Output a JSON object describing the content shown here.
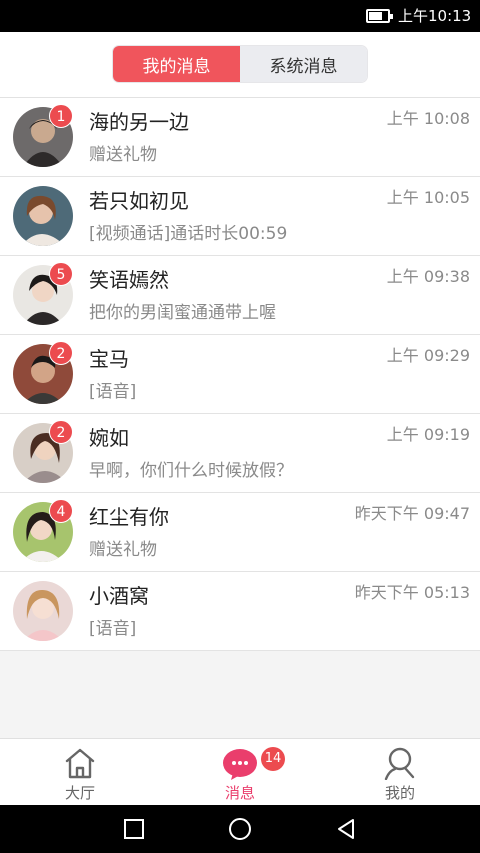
{
  "status_bar": {
    "time": "上午10:13",
    "battery_level": 0.7
  },
  "tabs": {
    "my_messages": "我的消息",
    "system_messages": "系统消息"
  },
  "messages": [
    {
      "name": "海的另一边",
      "preview": "赠送礼物",
      "time": "上午 10:08",
      "unread": "1",
      "avatar": "avatar-1"
    },
    {
      "name": "若只如初见",
      "preview": "[视频通话]通话时长00:59",
      "time": "上午 10:05",
      "unread": "",
      "avatar": "avatar-2"
    },
    {
      "name": "笑语嫣然",
      "preview": "把你的男闺蜜通通带上喔",
      "time": "上午 09:38",
      "unread": "5",
      "avatar": "avatar-3"
    },
    {
      "name": "宝马",
      "preview": "[语音]",
      "time": "上午 09:29",
      "unread": "2",
      "avatar": "avatar-4"
    },
    {
      "name": "婉如",
      "preview": "早啊，你们什么时候放假？",
      "time": "上午 09:19",
      "unread": "2",
      "avatar": "avatar-5"
    },
    {
      "name": "红尘有你",
      "preview": "赠送礼物",
      "time": "昨天下午 09:47",
      "unread": "4",
      "avatar": "avatar-6"
    },
    {
      "name": "小酒窝",
      "preview": "[语音]",
      "time": "昨天下午 05:13",
      "unread": "",
      "avatar": "avatar-7"
    }
  ],
  "bottom_nav": {
    "lobby": {
      "label": "大厅",
      "icon": "home-icon"
    },
    "messages": {
      "label": "消息",
      "icon": "chat-bubble-icon",
      "badge": "14"
    },
    "mine": {
      "label": "我的",
      "icon": "person-icon"
    }
  },
  "colors": {
    "accent": "#f0555c",
    "badge": "#ec4b4f",
    "active_nav": "#ea3e6c"
  }
}
